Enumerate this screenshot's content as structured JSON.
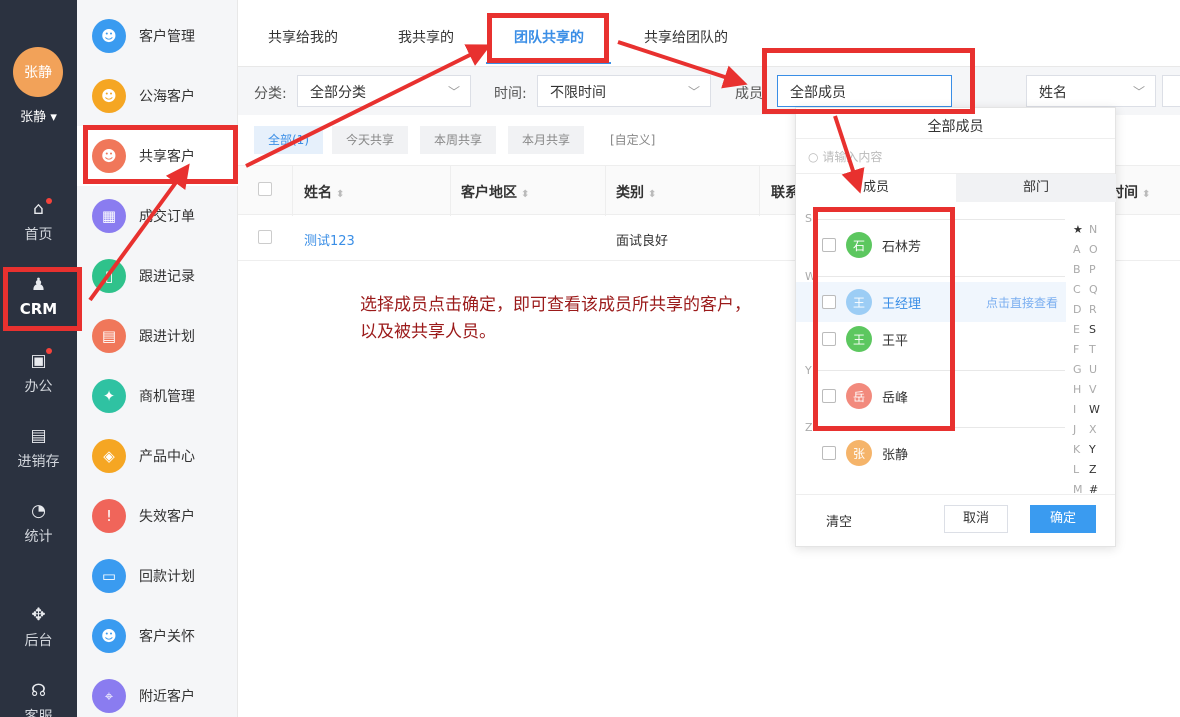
{
  "user": {
    "avatar_text": "张静",
    "name": "张静"
  },
  "rail": {
    "home": "首页",
    "crm": "CRM",
    "office": "办公",
    "inventory": "进销存",
    "stats": "统计",
    "backend": "后台",
    "service": "客服"
  },
  "menu": [
    {
      "label": "客户管理",
      "icon": "user-icon",
      "color": "#3a9bf0"
    },
    {
      "label": "公海客户",
      "icon": "user-icon",
      "color": "#f5a623"
    },
    {
      "label": "共享客户",
      "icon": "share-user-icon",
      "color": "#f0775a"
    },
    {
      "label": "成交订单",
      "icon": "order-icon",
      "color": "#8a7cf0"
    },
    {
      "label": "跟进记录",
      "icon": "book-icon",
      "color": "#2fc28b"
    },
    {
      "label": "跟进计划",
      "icon": "plan-icon",
      "color": "#f0775a"
    },
    {
      "label": "商机管理",
      "icon": "bulb-icon",
      "color": "#2fc2a2"
    },
    {
      "label": "产品中心",
      "icon": "box-icon",
      "color": "#f5a623"
    },
    {
      "label": "失效客户",
      "icon": "warning-icon",
      "color": "#f0655a"
    },
    {
      "label": "回款计划",
      "icon": "card-icon",
      "color": "#3a9bf0"
    },
    {
      "label": "客户关怀",
      "icon": "heart-user-icon",
      "color": "#3a9bf0"
    },
    {
      "label": "附近客户",
      "icon": "location-icon",
      "color": "#8a7cf0"
    }
  ],
  "tabs": [
    "共享给我的",
    "我共享的",
    "团队共享的",
    "共享给团队的"
  ],
  "filters": {
    "category_label": "分类:",
    "category_value": "全部分类",
    "time_label": "时间:",
    "time_value": "不限时间",
    "member_label": "成员",
    "member_value": "全部成员",
    "sort_value": "姓名"
  },
  "pills": [
    "全部(1)",
    "今天共享",
    "本周共享",
    "本月共享",
    "[自定义]"
  ],
  "columns": [
    "姓名",
    "客户地区",
    "类别",
    "联系",
    "时间"
  ],
  "rows": [
    {
      "name": "测试123",
      "region": "",
      "category": "面试良好"
    }
  ],
  "note": {
    "line1": "选择成员点击确定，即可查看该成员所共享的客户，",
    "line2": "以及被共享人员。"
  },
  "popup": {
    "title": "全部成员",
    "search_placeholder": "请输入内容",
    "tab_member": "成员",
    "tab_dept": "部门",
    "letters": [
      "S",
      "W",
      "Y",
      "Z"
    ],
    "members": [
      {
        "name": "石林芳",
        "avatar": "石",
        "color": "#5cc75f"
      },
      {
        "name": "王经理",
        "avatar": "王",
        "color": "#9ccdf5",
        "action": "点击直接查看"
      },
      {
        "name": "王平",
        "avatar": "王",
        "color": "#5cc75f"
      },
      {
        "name": "岳峰",
        "avatar": "岳",
        "color": "#f28a7d"
      },
      {
        "name": "张静",
        "avatar": "张",
        "color": "#f5b46a"
      }
    ],
    "index_left": [
      "★",
      "A",
      "B",
      "C",
      "D",
      "E",
      "F",
      "G",
      "H",
      "I",
      "J",
      "K",
      "L",
      "M"
    ],
    "index_right": [
      "N",
      "O",
      "P",
      "Q",
      "R",
      "S",
      "T",
      "U",
      "V",
      "W",
      "X",
      "Y",
      "Z",
      "#"
    ],
    "clear": "清空",
    "cancel": "取消",
    "confirm": "确定"
  }
}
